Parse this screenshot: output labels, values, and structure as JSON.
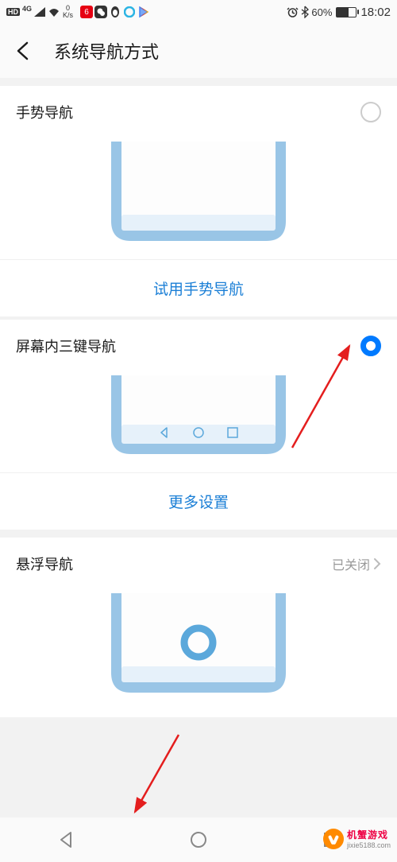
{
  "statusbar": {
    "net_speed_value": "0",
    "net_speed_unit": "K/s",
    "battery_percent": "60%",
    "time": "18:02"
  },
  "header": {
    "title": "系统导航方式"
  },
  "sections": {
    "gesture": {
      "title": "手势导航",
      "link": "试用手势导航"
    },
    "three_key": {
      "title": "屏幕内三键导航",
      "link": "更多设置"
    },
    "floating": {
      "title": "悬浮导航",
      "status": "已关闭"
    }
  },
  "watermark": {
    "brand": "机蟹游戏",
    "url": "jixie5188.com"
  }
}
